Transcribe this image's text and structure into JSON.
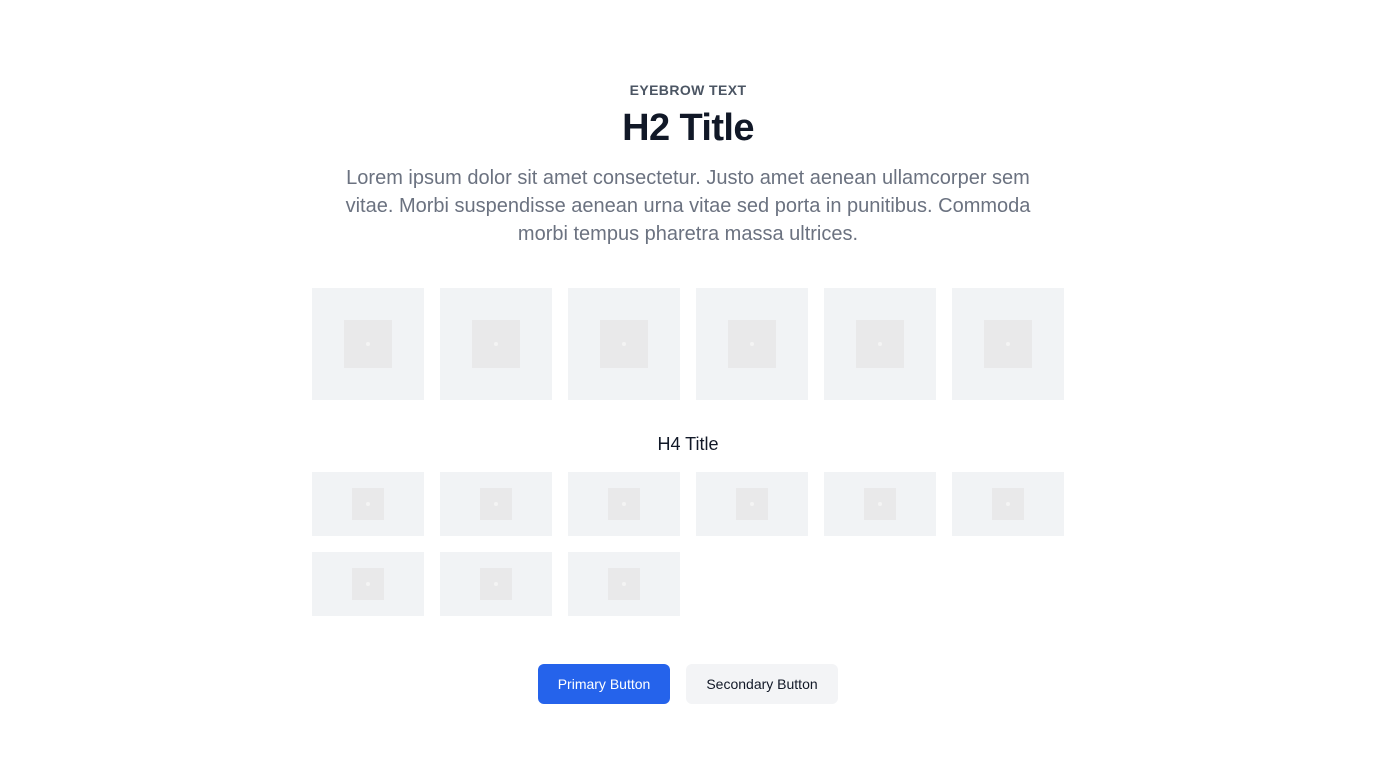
{
  "section": {
    "eyebrow": "EYEBROW TEXT",
    "title": "H2 Title",
    "description": "Lorem ipsum dolor sit amet consectetur. Justo amet aenean ullamcorper sem vitae. Morbi suspendisse aenean urna vitae sed porta in punitibus. Commoda morbi tempus pharetra massa ultrices.",
    "subtitle": "H4 Title"
  },
  "colors": {
    "primary": "#2563eb",
    "secondary_bg": "#f3f4f6",
    "tile_bg": "#f1f3f5",
    "placeholder": "#e9e9ea"
  },
  "featured_logos": [
    {
      "icon": "image-placeholder-icon"
    },
    {
      "icon": "image-placeholder-icon"
    },
    {
      "icon": "image-placeholder-icon"
    },
    {
      "icon": "image-placeholder-icon"
    },
    {
      "icon": "image-placeholder-icon"
    },
    {
      "icon": "image-placeholder-icon"
    }
  ],
  "secondary_logos": [
    {
      "icon": "image-placeholder-icon"
    },
    {
      "icon": "image-placeholder-icon"
    },
    {
      "icon": "image-placeholder-icon"
    },
    {
      "icon": "image-placeholder-icon"
    },
    {
      "icon": "image-placeholder-icon"
    },
    {
      "icon": "image-placeholder-icon"
    },
    {
      "icon": "image-placeholder-icon"
    },
    {
      "icon": "image-placeholder-icon"
    },
    {
      "icon": "image-placeholder-icon"
    }
  ],
  "buttons": {
    "primary_label": "Primary Button",
    "secondary_label": "Secondary Button"
  }
}
